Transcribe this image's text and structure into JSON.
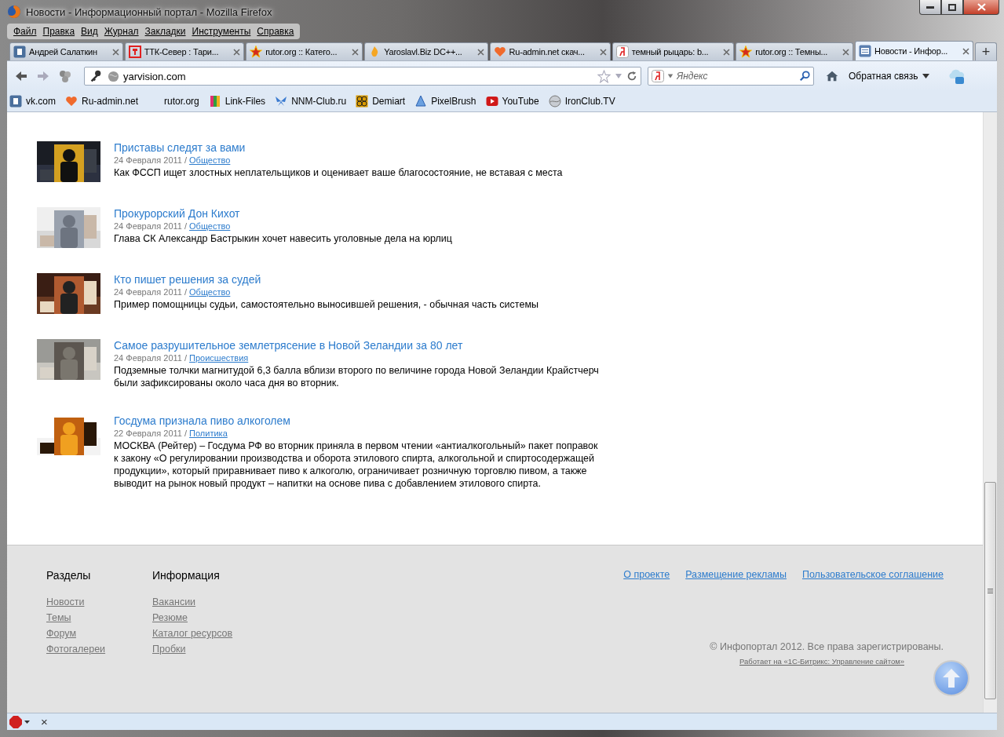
{
  "window": {
    "title": "Новости - Информационный портал - Mozilla Firefox"
  },
  "menu": [
    "Файл",
    "Правка",
    "Вид",
    "Журнал",
    "Закладки",
    "Инструменты",
    "Справка"
  ],
  "tabs": [
    {
      "label": "Андрей Салаткин",
      "kind": "square",
      "selected": false
    },
    {
      "label": "ТТК-Север : Тари...",
      "kind": "frame",
      "selected": false
    },
    {
      "label": "rutor.org :: Катего...",
      "kind": "star",
      "selected": false
    },
    {
      "label": "Yaroslavl.Biz DC++...",
      "kind": "flame",
      "selected": false
    },
    {
      "label": "Ru-admin.net скач...",
      "kind": "heart",
      "selected": false
    },
    {
      "label": "темный рыцарь: b...",
      "kind": "ya",
      "selected": false
    },
    {
      "label": "rutor.org :: Темны...",
      "kind": "star",
      "selected": false
    },
    {
      "label": "Новости - Инфор...",
      "kind": "page",
      "selected": true
    }
  ],
  "new_tab": "+",
  "address": {
    "value": "yarvision.com"
  },
  "search": {
    "placeholder": "Яндекс"
  },
  "feedback": "Обратная связь",
  "bookmarks": [
    {
      "label": "vk.com",
      "kind": "square"
    },
    {
      "label": "Ru-admin.net",
      "kind": "heart"
    },
    {
      "label": "rutor.org",
      "kind": "none"
    },
    {
      "label": "Link-Files",
      "kind": "book"
    },
    {
      "label": "NNM-Club.ru",
      "kind": "butterfly"
    },
    {
      "label": "Demiart",
      "kind": "tile"
    },
    {
      "label": "PixelBrush",
      "kind": "drop"
    },
    {
      "label": "YouTube",
      "kind": "play"
    },
    {
      "label": "IronClub.TV",
      "kind": "globe"
    }
  ],
  "articles": [
    {
      "title": "Приставы следят за вами",
      "date": "24 Февраля 2011 /",
      "category": "Общество",
      "text": "Как ФССП ищет злостных неплательщиков и оценивает ваше благосостояние, не вставая с места",
      "kind": "picture"
    },
    {
      "title": "Прокурорский Дон Кихот",
      "date": "24 Февраля 2011 /",
      "category": "Общество",
      "text": "Глава СК Александр Бастрыкин хочет навесить уголовные дела на юрлиц",
      "kind": "picture"
    },
    {
      "title": "Кто пишет решения за судей",
      "date": "24 Февраля 2011 /",
      "category": "Общество",
      "text": "Пример помощницы судьи, самостоятельно выносившей решения, - обычная часть системы",
      "kind": "picture"
    },
    {
      "title": "Самое разрушительное землетрясение в Новой Зеландии за 80 лет",
      "date": "24 Февраля 2011 /",
      "category": "Происшествия",
      "text": "Подземные толчки магнитудой 6,3 балла вблизи второго по величине города Новой Зеландии Крайстчерч были зафиксированы около часа дня во вторник.",
      "kind": "picture"
    },
    {
      "title": "Госдума признала пиво алкоголем",
      "date": "22 Февраля 2011 /",
      "category": "Политика",
      "text": "МОСКВА (Рейтер) – Госдума РФ во вторник приняла в первом чтении «антиалкогольный» пакет поправок к закону «О регулировании производства и оборота этилового спирта, алкогольной и спиртосодержащей продукции», который приравнивает пиво к алкоголю, ограничивает розничную торговлю пивом, а также выводит на рынок новый продукт – напитки на основе пива с добавлением этилового спирта.",
      "kind": "picture"
    }
  ],
  "footer": {
    "columns": [
      {
        "heading": "Разделы",
        "links": [
          "Новости",
          "Темы",
          "Форум",
          "Фотогалереи"
        ]
      },
      {
        "heading": "Информация",
        "links": [
          "Вакансии",
          "Резюме",
          "Каталог ресурсов",
          "Пробки"
        ]
      }
    ],
    "top_links": [
      "О проекте",
      "Размещение рекламы",
      "Пользовательское соглашение"
    ],
    "copyright": "© Инфопортал 2012. Все права зарегистрированы.",
    "powered": "Работает на «1С-Битрикс: Управление сайтом»"
  },
  "status_bar": {
    "close": "×"
  }
}
